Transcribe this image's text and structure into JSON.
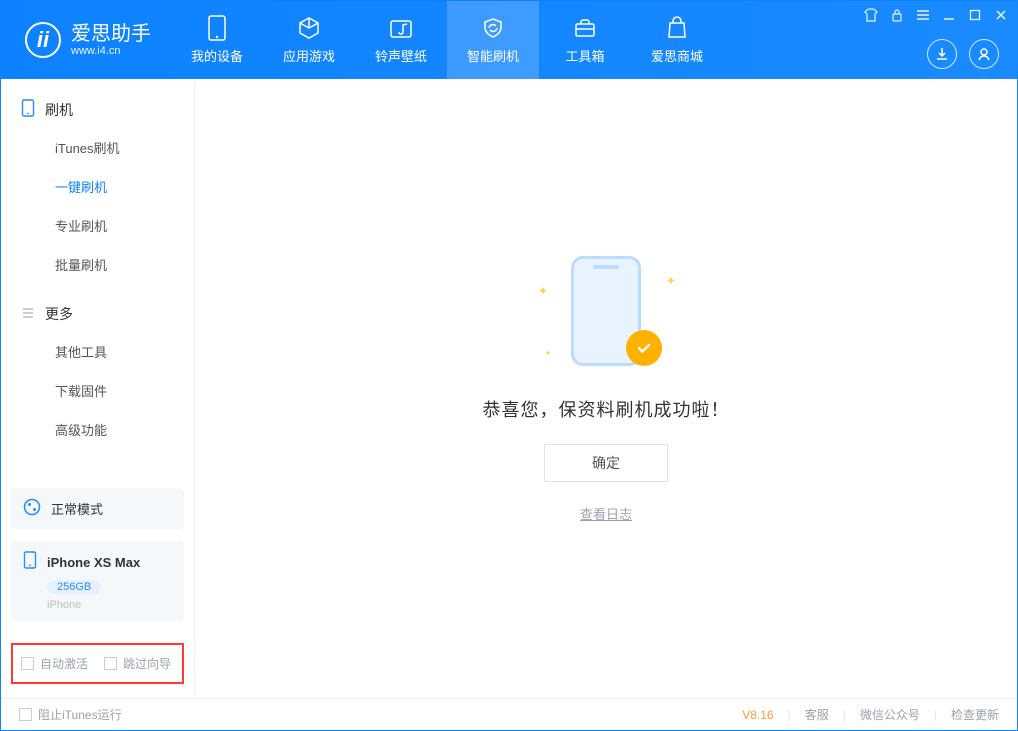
{
  "app": {
    "title": "爱思助手",
    "subtitle": "www.i4.cn"
  },
  "tabs": [
    {
      "label": "我的设备"
    },
    {
      "label": "应用游戏"
    },
    {
      "label": "铃声壁纸"
    },
    {
      "label": "智能刷机"
    },
    {
      "label": "工具箱"
    },
    {
      "label": "爱思商城"
    }
  ],
  "sidebar": {
    "flash_header": "刷机",
    "flash_items": [
      "iTunes刷机",
      "一键刷机",
      "专业刷机",
      "批量刷机"
    ],
    "more_header": "更多",
    "more_items": [
      "其他工具",
      "下载固件",
      "高级功能"
    ],
    "mode_label": "正常模式",
    "device": {
      "name": "iPhone XS Max",
      "capacity": "256GB",
      "type": "iPhone"
    },
    "chk_auto_activate": "自动激活",
    "chk_skip_guide": "跳过向导"
  },
  "main": {
    "message": "恭喜您，保资料刷机成功啦！",
    "confirm": "确定",
    "view_log": "查看日志"
  },
  "status": {
    "block_itunes": "阻止iTunes运行",
    "version": "V8.16",
    "support": "客服",
    "wechat": "微信公众号",
    "check_update": "检查更新"
  }
}
